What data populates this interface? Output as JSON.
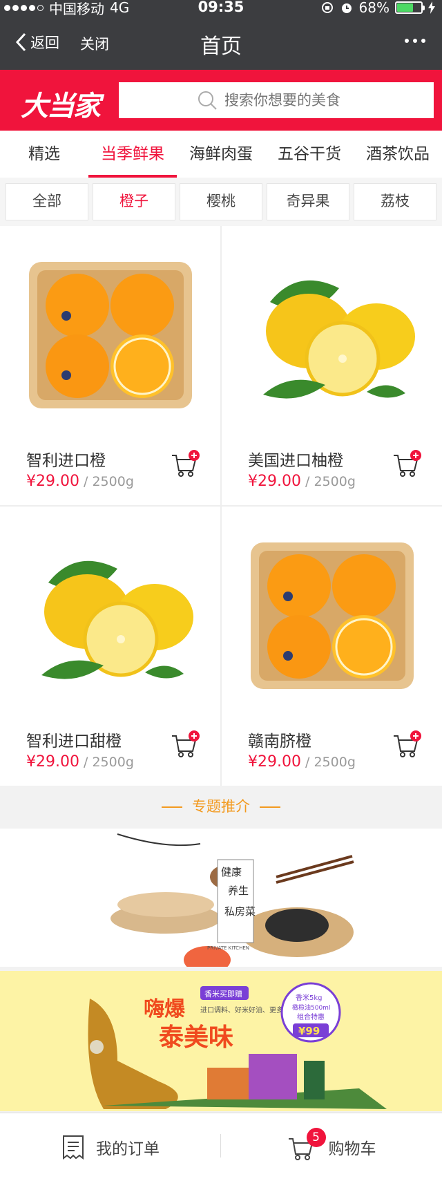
{
  "status": {
    "carrier": "中国移动",
    "network": "4G",
    "time": "09:35",
    "battery": "68%",
    "battery_level": 0.68
  },
  "nav": {
    "back_label": "返回",
    "close_label": "关闭",
    "title": "首页"
  },
  "brand": {
    "logo_text": "大当家"
  },
  "search": {
    "placeholder": "搜索你想要的美食"
  },
  "tabs": [
    {
      "label": "精选",
      "active": false
    },
    {
      "label": "当季鲜果",
      "active": true
    },
    {
      "label": "海鲜肉蛋",
      "active": false
    },
    {
      "label": "五谷干货",
      "active": false
    },
    {
      "label": "酒茶饮品",
      "active": false
    }
  ],
  "filters": [
    {
      "label": "全部",
      "active": false
    },
    {
      "label": "橙子",
      "active": true
    },
    {
      "label": "樱桃",
      "active": false
    },
    {
      "label": "奇异果",
      "active": false
    },
    {
      "label": "荔枝",
      "active": false
    }
  ],
  "products": [
    {
      "name": "智利进口橙",
      "price": "¥29.00",
      "unit": " / 2500g",
      "image": "oranges-in-tray"
    },
    {
      "name": "美国进口柚橙",
      "price": "¥29.00",
      "unit": " / 2500g",
      "image": "lemons-with-leaves"
    },
    {
      "name": "智利进口甜橙",
      "price": "¥29.00",
      "unit": " / 2500g",
      "image": "lemons-with-leaves"
    },
    {
      "name": "赣南脐橙",
      "price": "¥29.00",
      "unit": " / 2500g",
      "image": "oranges-in-tray"
    }
  ],
  "topic": {
    "title": "专题推介"
  },
  "banners": {
    "b1": {
      "line1": "健康",
      "line2": "养生",
      "line3": "私房菜",
      "sub": "PRIVATE KITCHEN"
    },
    "b2": {
      "tag": "香米买即赠",
      "headline1": "嗨爆",
      "headline2": "泰美味",
      "sub": "进口调料、好米好油、更多美味...",
      "promo_top": "香米5kg",
      "promo_mid": "橄榄油500ml",
      "promo_bottom": "组合特惠",
      "promo_price": "¥99"
    }
  },
  "bottom": {
    "orders_label": "我的订单",
    "cart_label": "购物车",
    "cart_count": "5"
  },
  "colors": {
    "accent": "#f0143c",
    "topic": "#f39a1f",
    "nav_bg": "#3c3d40"
  }
}
